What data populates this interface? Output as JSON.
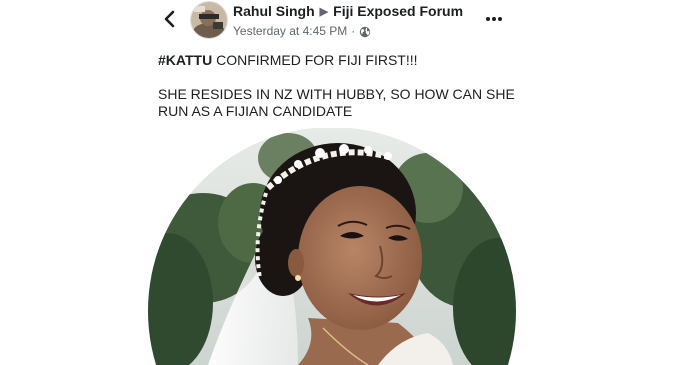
{
  "header": {
    "author": "Rahul Singh",
    "separator_icon": "right-triangle-arrow",
    "group": "Fiji Exposed Forum",
    "timestamp": "Yesterday at 4:45 PM",
    "dot": "·",
    "privacy_icon": "globe-icon"
  },
  "icons": {
    "back": "chevron-left-icon",
    "more": "more-horizontal-icon"
  },
  "post": {
    "hashtag": "#KATTU",
    "line1_rest": " CONFIRMED FOR FIJI FIRST!!!",
    "line2": "SHE RESIDES IN NZ WITH HUBBY, SO HOW CAN SHE RUN AS A FIJIAN CANDIDATE"
  },
  "photo": {
    "subject": "smiling-bride-with-tiara-and-veil"
  },
  "colors": {
    "text": "#1c1e21",
    "secondary": "#606770"
  }
}
